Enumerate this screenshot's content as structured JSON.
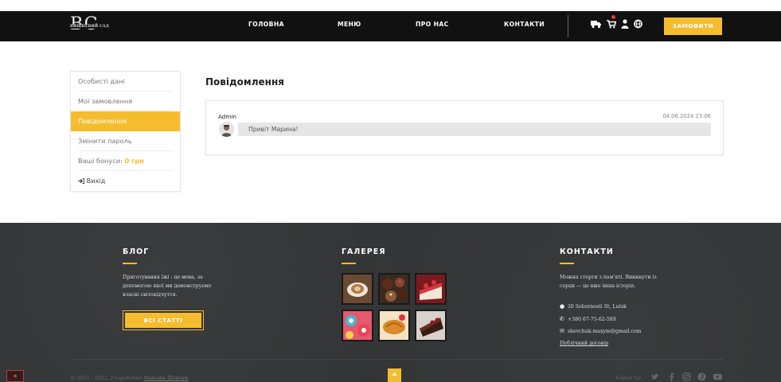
{
  "header": {
    "logo_text": "BC",
    "logo_subtitle": "ВИШНЕВИЙ САД",
    "nav": [
      "ГОЛОВНА",
      "МЕНЮ",
      "ПРО НАС",
      "КОНТАКТИ"
    ],
    "icons": [
      "delivery-truck-icon",
      "cart-icon",
      "user-icon",
      "globe-icon"
    ],
    "order_button": "ЗАМОВИТИ"
  },
  "sidebar": {
    "items": [
      {
        "label": "Особисті дані",
        "active": false
      },
      {
        "label": "Мої замовлення",
        "active": false
      },
      {
        "label": "Повідомлення",
        "active": true
      },
      {
        "label": "Змінити пароль",
        "active": false
      }
    ],
    "bonus_label": "Ваші бонуси:",
    "bonus_value": "0 грн",
    "logout_icon": "sign-out-icon",
    "logout_label": "Вихід"
  },
  "main": {
    "title": "Повідомлення",
    "message": {
      "author": "Admin",
      "date": "04.06.2024 23:06",
      "text": "Привіт Марина!"
    }
  },
  "footer": {
    "blog": {
      "title": "БЛОГ",
      "text_lines": [
        "Приготування їжі - це мова, за",
        "допомогою якої ми демонструємо",
        "власні світовідчуття."
      ],
      "button": "ВСІ СТАТТІ"
    },
    "gallery": {
      "title": "ГАЛЕРЕЯ",
      "images": [
        "coffee-cup",
        "chocolate-cupcakes",
        "strawberry-cake",
        "macarons",
        "croissant",
        "chocolate-cake"
      ]
    },
    "contacts": {
      "title": "КОНТАКТИ",
      "text_lines": [
        "Можна стерти з пам'яті. Викинути із",
        "серця — це вже інша історія."
      ],
      "address": "20 Sobornosti St, Lutsk",
      "phone": "+380 67-75-62-589",
      "email": "shevchuk.maxym@gmail.com",
      "contract_link": "Публічний договір"
    },
    "copyright_prefix": "© 2021 - 2022, Розроблено",
    "copyright_author": "Максим Шевчук",
    "follow_label": "Follow Us",
    "social": [
      "twitter-icon",
      "facebook-icon",
      "instagram-icon",
      "pinterest-icon",
      "youtube-icon"
    ],
    "up_icon": "arrow-up-icon"
  },
  "colors": {
    "accent": "#f5bd2e",
    "header_bg": "#111111",
    "footer_bg": "#333435"
  }
}
